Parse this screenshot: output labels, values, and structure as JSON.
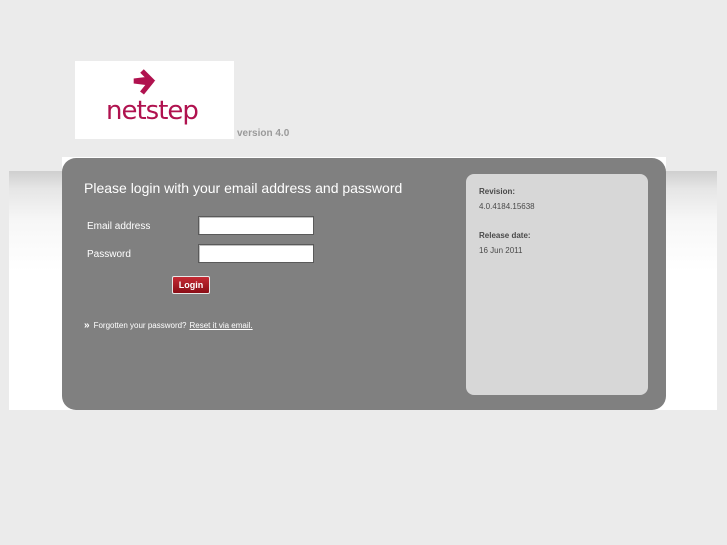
{
  "brand": {
    "logo_text": "netstep",
    "version": "version 4.0",
    "color": "#b0124f"
  },
  "login": {
    "title": "Please login with your email address and password",
    "email_label": "Email address",
    "email_value": "",
    "password_label": "Password",
    "password_value": "",
    "button_label": "Login",
    "forgot_icon": "»",
    "forgot_text": "Forgotten your password?",
    "reset_link": "Reset it via email."
  },
  "info": {
    "revision_label": "Revision:",
    "revision_value": "4.0.4184.15638",
    "release_label": "Release date:",
    "release_value": "16 Jun 2011"
  },
  "colors": {
    "panel": "#808080",
    "info_box": "#d7d7d7",
    "button": "#a3141f"
  }
}
